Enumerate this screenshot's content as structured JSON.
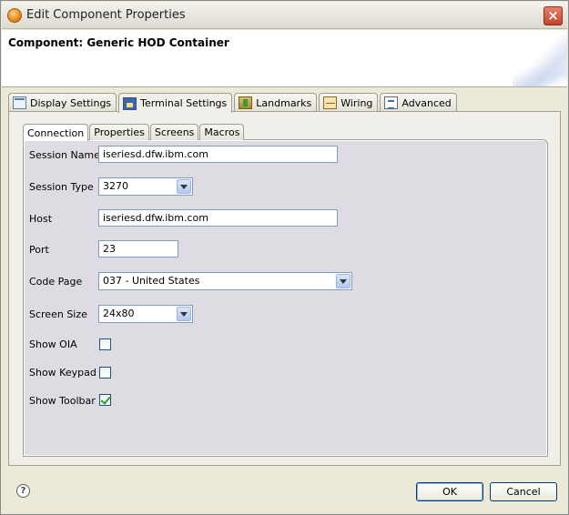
{
  "window": {
    "title": "Edit Component Properties",
    "close_glyph": "×"
  },
  "header": {
    "title": "Component: Generic HOD Container"
  },
  "outer_tabs": [
    {
      "label": "Display Settings",
      "icon": "display-settings-icon"
    },
    {
      "label": "Terminal Settings",
      "icon": "terminal-icon",
      "active": true
    },
    {
      "label": "Landmarks",
      "icon": "landmarks-icon"
    },
    {
      "label": "Wiring",
      "icon": "wiring-icon"
    },
    {
      "label": "Advanced",
      "icon": "advanced-icon"
    }
  ],
  "inner_tabs": [
    {
      "label": "Connection",
      "active": true
    },
    {
      "label": "Properties"
    },
    {
      "label": "Screens"
    },
    {
      "label": "Macros"
    }
  ],
  "form": {
    "session_name": {
      "label": "Session Name",
      "value": "iseriesd.dfw.ibm.com"
    },
    "session_type": {
      "label": "Session Type",
      "value": "3270"
    },
    "host": {
      "label": "Host",
      "value": "iseriesd.dfw.ibm.com"
    },
    "port": {
      "label": "Port",
      "value": "23"
    },
    "code_page": {
      "label": "Code Page",
      "value": "037 - United States"
    },
    "screen_size": {
      "label": "Screen Size",
      "value": "24x80"
    },
    "show_oia": {
      "label": "Show OIA",
      "checked": false
    },
    "show_keypad": {
      "label": "Show Keypad",
      "checked": false
    },
    "show_toolbar": {
      "label": "Show Toolbar",
      "checked": true
    }
  },
  "footer": {
    "help_glyph": "?",
    "ok_label": "OK",
    "cancel_label": "Cancel"
  }
}
